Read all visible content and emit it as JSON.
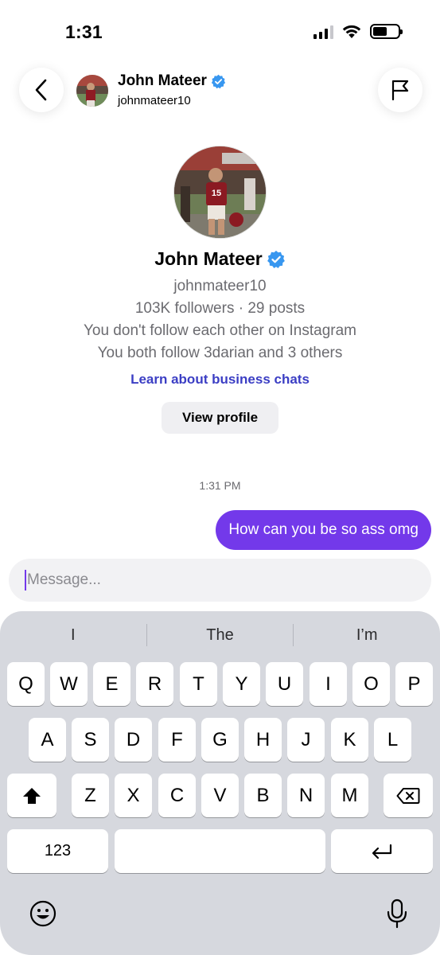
{
  "status_bar": {
    "time": "1:31"
  },
  "header": {
    "name": "John Mateer",
    "handle": "johnmateer10"
  },
  "profile": {
    "name": "John Mateer",
    "handle": "johnmateer10",
    "stats": "103K followers · 29 posts",
    "follow_status": "You don't follow each other on Instagram",
    "mutual": "You both follow 3darian and 3 others",
    "learn_link": "Learn about business chats",
    "view_profile_label": "View profile"
  },
  "messages": {
    "timestamp": "1:31 PM",
    "items": [
      {
        "from": "me",
        "text": "How can you be so ass omg"
      }
    ]
  },
  "composer": {
    "placeholder": "Message...",
    "value": ""
  },
  "keyboard": {
    "suggestions": [
      "I",
      "The",
      "I’m"
    ],
    "row1": [
      "Q",
      "W",
      "E",
      "R",
      "T",
      "Y",
      "U",
      "I",
      "O",
      "P"
    ],
    "row2": [
      "A",
      "S",
      "D",
      "F",
      "G",
      "H",
      "J",
      "K",
      "L"
    ],
    "row3": [
      "Z",
      "X",
      "C",
      "V",
      "B",
      "N",
      "M"
    ],
    "numbers_label": "123"
  },
  "icons": {
    "back": "chevron-left-icon",
    "flag": "flag-icon",
    "verified": "verified-badge-icon",
    "shift": "shift-icon",
    "delete": "backspace-icon",
    "return": "return-icon",
    "emoji": "emoji-icon",
    "mic": "microphone-icon"
  },
  "colors": {
    "accent": "#7339ea",
    "link": "#3b3ec4",
    "verified": "#3897f0"
  }
}
